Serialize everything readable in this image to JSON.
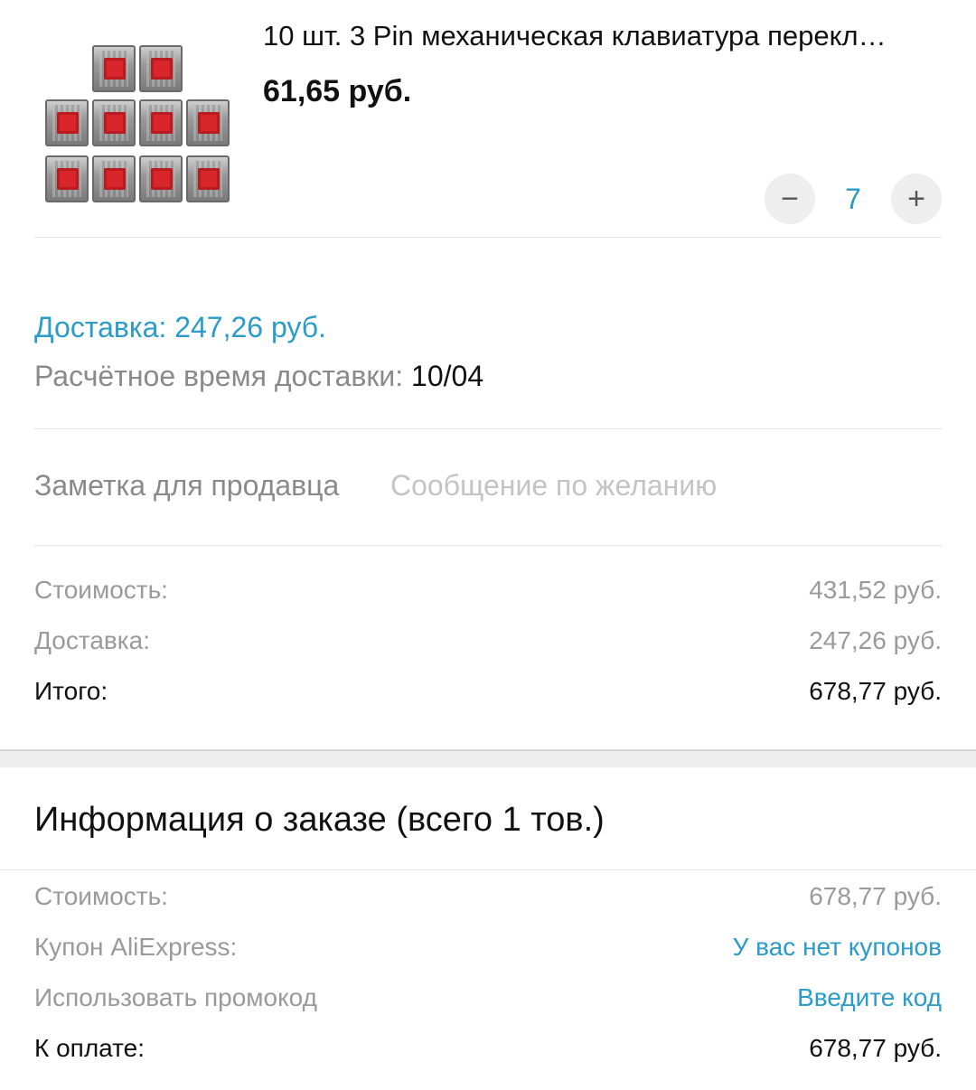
{
  "product": {
    "title": "10 шт. 3 Pin механическая клавиатура перекл…",
    "price": "61,65 руб.",
    "quantity": "7",
    "minus_symbol": "−",
    "plus_symbol": "+",
    "image_icon": "red-keyboard-switches-image"
  },
  "delivery": {
    "price_text": "Доставка: 247,26 руб.",
    "time_label": "Расчётное время доставки: ",
    "time_value": "10/04"
  },
  "note": {
    "label": "Заметка для продавца",
    "placeholder": "Сообщение по желанию"
  },
  "summary": {
    "cost_label": "Стоимость:",
    "cost_value": "431,52 руб.",
    "delivery_label": "Доставка:",
    "delivery_value": "247,26 руб.",
    "total_label": "Итого:",
    "total_value": "678,77 руб."
  },
  "order_info": {
    "title": "Информация о заказе (всего 1 тов.)",
    "cost_label": "Стоимость:",
    "cost_value": "678,77 руб.",
    "coupon_label": "Купон AliExpress:",
    "coupon_value": "У вас нет купонов",
    "promo_label": "Использовать промокод",
    "promo_value": "Введите код",
    "pay_label": "К оплате:",
    "pay_value": "678,77 руб."
  },
  "colors": {
    "accent": "#2b9bc7",
    "muted_text": "#9a9a9a",
    "switch_red": "#d8262a"
  }
}
